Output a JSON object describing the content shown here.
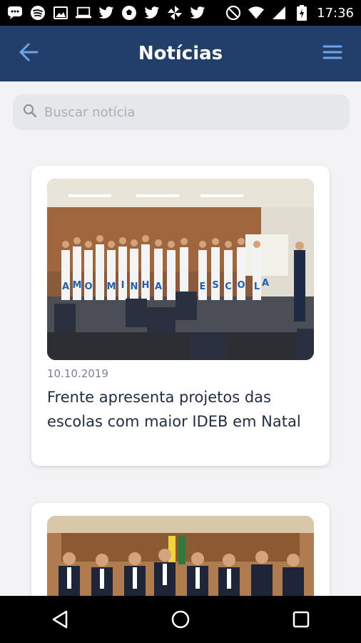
{
  "status_bar": {
    "time": "17:36",
    "left_icons": [
      "messaging-icon",
      "spotify-icon",
      "image-icon",
      "computer-icon",
      "twitter-icon",
      "soccer-icon",
      "twitter-icon",
      "pinwheel-icon",
      "twitter-icon"
    ],
    "right_icons": [
      "do-not-disturb-icon",
      "wifi-icon",
      "signal-icon",
      "battery-icon"
    ]
  },
  "app_bar": {
    "title": "Notícias",
    "back_icon": "arrow-left-icon",
    "menu_icon": "hamburger-menu-icon",
    "background": "#213f6a"
  },
  "search": {
    "placeholder": "Buscar notícia",
    "value": ""
  },
  "news": [
    {
      "date": "10.10.2019",
      "title": "Frente apresenta projetos das escolas com maior IDEB em Natal",
      "image_signs": [
        "A",
        "M",
        "O",
        "M",
        "I",
        "N",
        "H",
        "A",
        "E",
        "S",
        "C",
        "O",
        "L",
        "A"
      ]
    },
    {
      "date": "",
      "title": ""
    }
  ],
  "nav_bar": {
    "icons": [
      "back-triangle-icon",
      "home-circle-icon",
      "recents-square-icon"
    ]
  }
}
